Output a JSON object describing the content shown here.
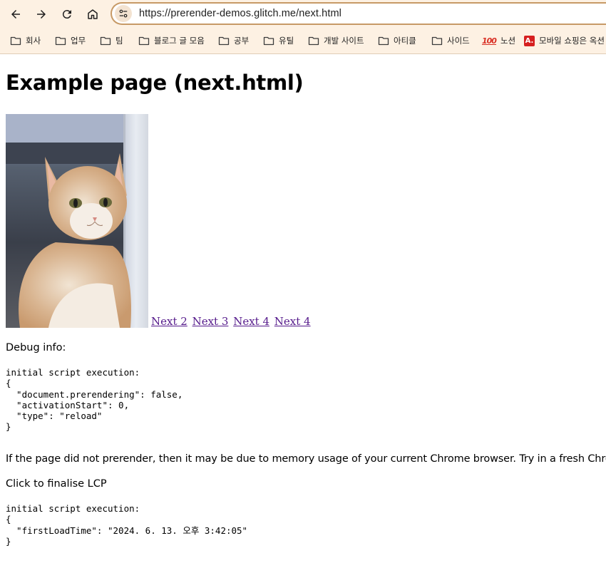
{
  "browser": {
    "url": "https://prerender-demos.glitch.me/next.html",
    "buttons": {
      "back_icon": "arrow-left-icon",
      "forward_icon": "arrow-right-icon",
      "reload_icon": "reload-icon",
      "home_icon": "home-icon",
      "site_info_icon": "tune-icon"
    },
    "bookmarks": [
      {
        "label": "회사",
        "icon": "folder-icon"
      },
      {
        "label": "업무",
        "icon": "folder-icon"
      },
      {
        "label": "팀",
        "icon": "folder-icon"
      },
      {
        "label": "블로그 글 모음",
        "icon": "folder-icon"
      },
      {
        "label": "공부",
        "icon": "folder-icon"
      },
      {
        "label": "유틸",
        "icon": "folder-icon"
      },
      {
        "label": "개발 사이트",
        "icon": "folder-icon"
      },
      {
        "label": "아티클",
        "icon": "folder-icon"
      },
      {
        "label": "사이드",
        "icon": "folder-icon"
      },
      {
        "label": "노션",
        "icon": "hundred-points-emoji"
      },
      {
        "label": "모바일 쇼핑은 옥션",
        "icon": "auction-logo",
        "badge": "A."
      }
    ]
  },
  "page": {
    "title": "Example page (next.html)",
    "image_alt": "cat",
    "links": [
      "Next 2",
      "Next 3",
      "Next 4",
      "Next 4"
    ],
    "debug_label": "Debug info:",
    "debug_block_1": "initial script execution:\n{\n  \"document.prerendering\": false,\n  \"activationStart\": 0,\n  \"type\": \"reload\"\n}",
    "note": "If the page did not prerender, then it may be due to memory usage of your current Chrome browser. Try in a fresh Chrome.",
    "lcp_text": "Click to finalise LCP",
    "debug_block_2": "initial script execution:\n{\n  \"firstLoadTime\": \"2024. 6. 13. 오후 3:42:05\"\n}"
  },
  "colors": {
    "chrome_bg": "#fdf1e3",
    "omnibox_border": "#c79a66",
    "visited_link": "#551a8b"
  }
}
